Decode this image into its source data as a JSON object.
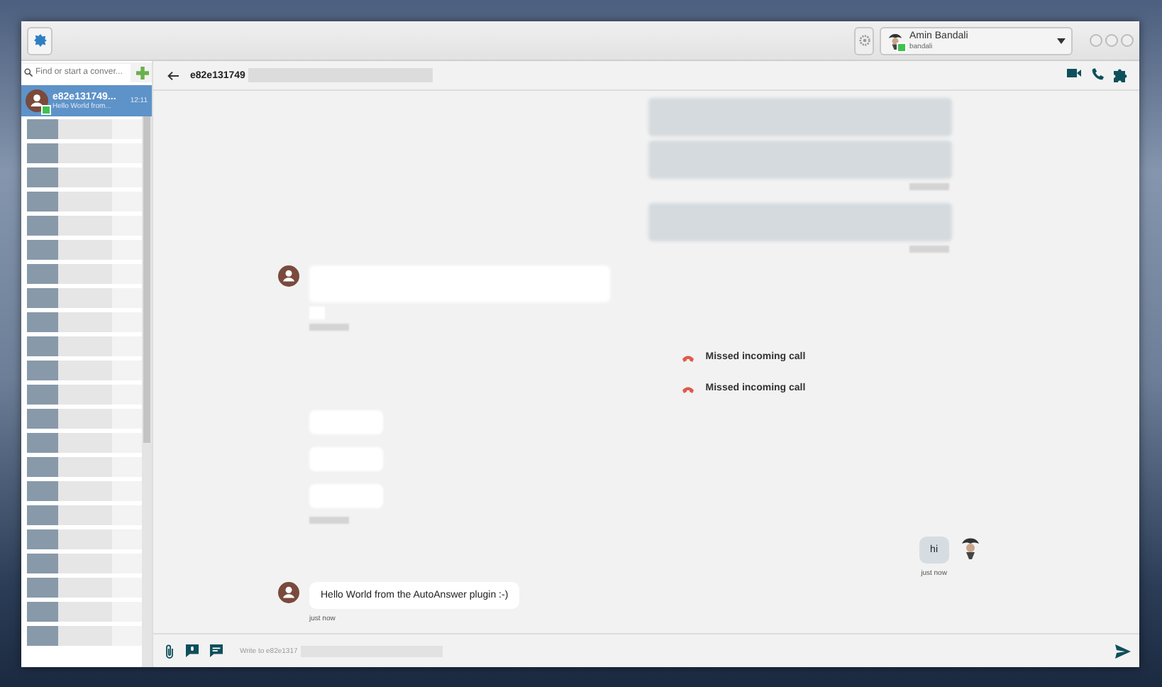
{
  "titlebar": {
    "account": {
      "name": "Amin Bandali",
      "username": "bandali",
      "online": true
    }
  },
  "sidebar": {
    "search": {
      "placeholder": "Find or start a conver..."
    },
    "conversations": [
      {
        "name": "e82e131749...",
        "preview": "Hello World from...",
        "time": "12:11",
        "selected": true,
        "online": true
      }
    ]
  },
  "chat": {
    "title": "e82e131749",
    "messages": [
      {
        "kind": "file-out"
      },
      {
        "kind": "file-out"
      },
      {
        "kind": "time-out"
      },
      {
        "kind": "file-out"
      },
      {
        "kind": "time-out"
      },
      {
        "kind": "file-in",
        "avatar": true
      },
      {
        "kind": "dot-in"
      },
      {
        "kind": "time-in"
      },
      {
        "kind": "call",
        "text": "Missed incoming call"
      },
      {
        "kind": "call",
        "text": "Missed incoming call"
      },
      {
        "kind": "bubble-in"
      },
      {
        "kind": "bubble-in"
      },
      {
        "kind": "bubble-in"
      },
      {
        "kind": "time-in"
      },
      {
        "kind": "text-out",
        "text": "hi",
        "time": "just now",
        "avatar": true
      },
      {
        "kind": "text-in",
        "text": "Hello World from the AutoAnswer plugin :-)",
        "time": "just now",
        "avatar": true
      }
    ],
    "composer": {
      "placeholder": "Write to e82e1317"
    }
  }
}
